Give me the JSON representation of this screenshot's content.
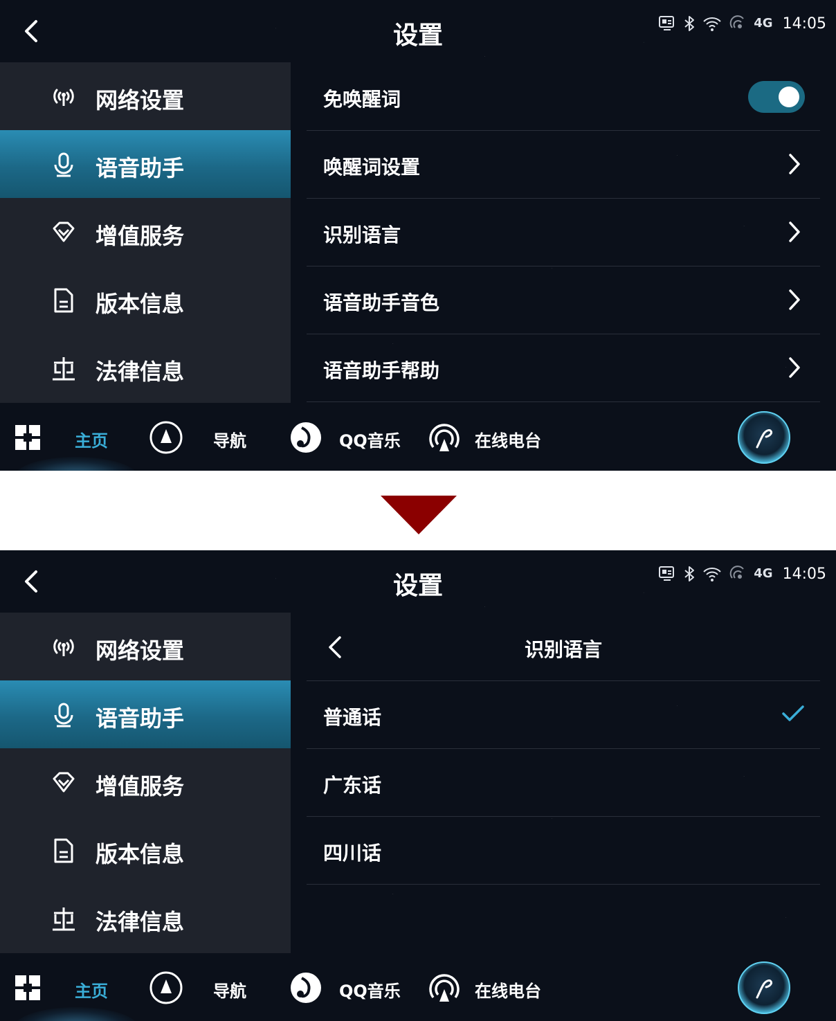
{
  "colors": {
    "accent": "#3aaed8",
    "sidebar_active": "#1c6887",
    "toggle": "#1b6a83",
    "divider_arrow": "#8b0000"
  },
  "status": {
    "time": "14:05",
    "network": "4G"
  },
  "screen1": {
    "title": "设置",
    "sidebar": [
      {
        "label": "网络设置",
        "icon": "antenna-icon"
      },
      {
        "label": "语音助手",
        "icon": "microphone-icon",
        "active": true
      },
      {
        "label": "增值服务",
        "icon": "diamond-icon"
      },
      {
        "label": "版本信息",
        "icon": "document-icon"
      },
      {
        "label": "法律信息",
        "icon": "scale-icon"
      }
    ],
    "rows": [
      {
        "label": "免唤醒词",
        "control": "toggle",
        "on": true
      },
      {
        "label": "唤醒词设置",
        "control": "chevron"
      },
      {
        "label": "识别语言",
        "control": "chevron"
      },
      {
        "label": "语音助手音色",
        "control": "chevron"
      },
      {
        "label": "语音助手帮助",
        "control": "chevron"
      }
    ]
  },
  "screen2": {
    "title": "设置",
    "sub_title": "识别语言",
    "options": [
      {
        "label": "普通话",
        "selected": true
      },
      {
        "label": "广东话",
        "selected": false
      },
      {
        "label": "四川话",
        "selected": false
      }
    ]
  },
  "bottom_nav": {
    "home": "主页",
    "navigation": "导航",
    "music": "QQ音乐",
    "radio": "在线电台"
  }
}
